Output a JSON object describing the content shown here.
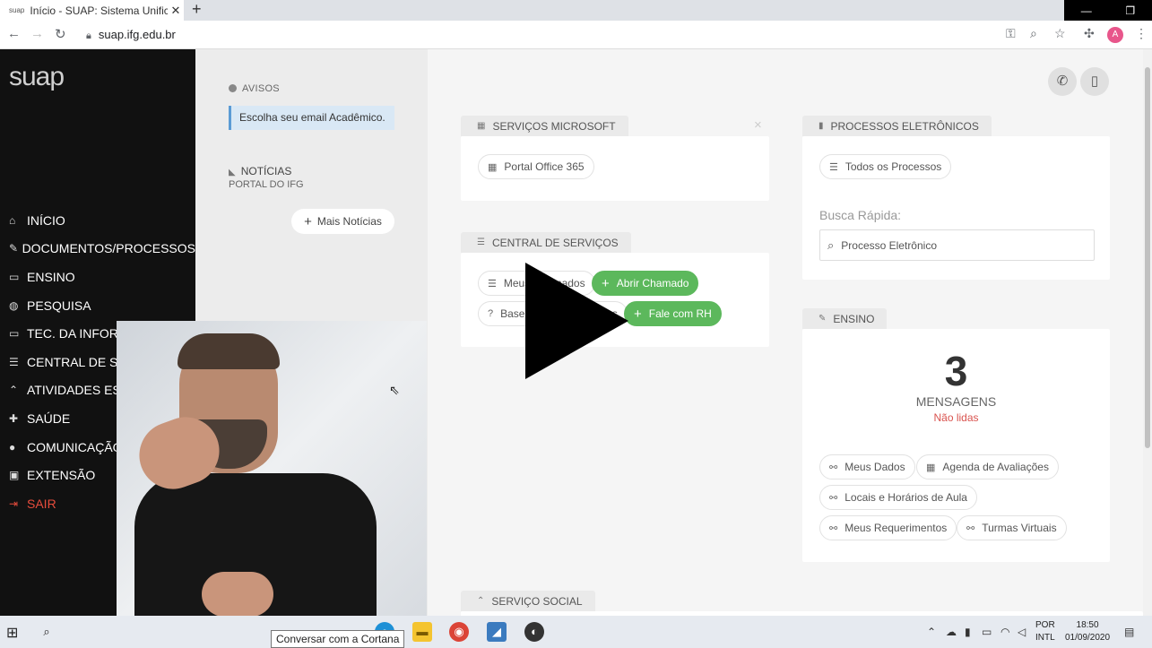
{
  "browser": {
    "tab_title": "Início - SUAP: Sistema Unificado",
    "tab_favicon": "suap",
    "new_tab": "+",
    "url": "suap.ifg.edu.br",
    "profile_initial": "A"
  },
  "sidebar": {
    "logo": "suap",
    "items": [
      {
        "label": "INÍCIO",
        "icon": "home-icon",
        "glyph": "⌂"
      },
      {
        "label": "DOCUMENTOS/PROCESSOS",
        "icon": "edit-icon",
        "glyph": "✎"
      },
      {
        "label": "ENSINO",
        "icon": "board-icon",
        "glyph": "▭"
      },
      {
        "label": "PESQUISA",
        "icon": "globe-icon",
        "glyph": "◍"
      },
      {
        "label": "TEC. DA INFORMAÇÃO",
        "icon": "laptop-icon",
        "glyph": "▭"
      },
      {
        "label": "CENTRAL DE SERVIÇOS",
        "icon": "list-icon",
        "glyph": "☰"
      },
      {
        "label": "ATIVIDADES ESTUDANTIS",
        "icon": "graduation-icon",
        "glyph": "⌃"
      },
      {
        "label": "SAÚDE",
        "icon": "medkit-icon",
        "glyph": "✚"
      },
      {
        "label": "COMUNICAÇÃO SOCIAL",
        "icon": "comment-icon",
        "glyph": "●"
      },
      {
        "label": "EXTENSÃO",
        "icon": "briefcase-icon",
        "glyph": "▣"
      },
      {
        "label": "SAIR",
        "icon": "sign-out-icon",
        "glyph": "⇥"
      }
    ]
  },
  "avisos": {
    "title": "AVISOS",
    "alert": "Escolha seu email Acadêmico."
  },
  "noticias": {
    "title": "NOTÍCIAS",
    "subtitle": "PORTAL DO IFG",
    "more_button": "Mais Notícias"
  },
  "servicos_microsoft": {
    "title": "SERVIÇOS MICROSOFT",
    "close": "×",
    "portal_button": "Portal Office 365"
  },
  "central_servicos": {
    "title": "CENTRAL DE SERVIÇOS",
    "meus_chamados": "Meus Chamados",
    "abrir_chamado": "Abrir Chamado",
    "base": "Base de Conhecimentos",
    "fale_rh": "Fale com RH"
  },
  "processos": {
    "title": "PROCESSOS ELETRÔNICOS",
    "todos_button": "Todos os Processos",
    "busca_label": "Busca Rápida:",
    "busca_placeholder": "Processo Eletrônico"
  },
  "ensino": {
    "title": "ENSINO",
    "count": "3",
    "count_label": "MENSAGENS",
    "count_sub": "Não lidas",
    "links": [
      "Meus Dados",
      "Agenda de Avaliações",
      "Locais e Horários de Aula",
      "Meus Requerimentos",
      "Turmas Virtuais"
    ]
  },
  "servico_social": {
    "title": "SERVIÇO SOCIAL"
  },
  "taskbar": {
    "cortana_tooltip": "Conversar com a Cortana",
    "lang_line1": "POR",
    "lang_line2": "INTL",
    "time": "18:50",
    "date": "01/09/2020"
  },
  "colors": {
    "sidebar_bg": "#111111",
    "green": "#5cb85c",
    "danger": "#d9534f",
    "alert_bg": "#d9e8f5"
  }
}
